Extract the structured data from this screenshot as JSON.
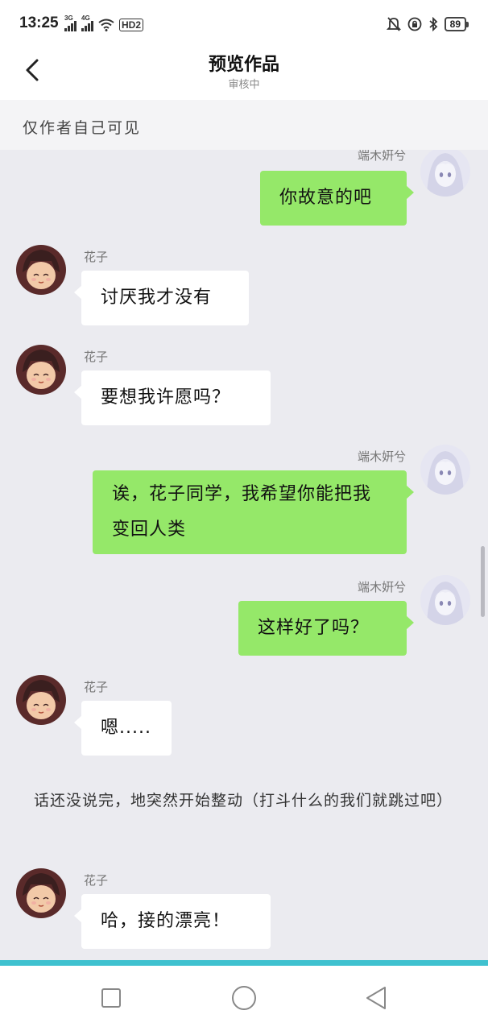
{
  "status": {
    "time": "13:25",
    "sim1": "3G",
    "sim2": "4G",
    "hd": "HD2",
    "battery": "89"
  },
  "header": {
    "title": "预览作品",
    "subtitle": "审核中"
  },
  "notice": "仅作者自己可见",
  "messages": [
    {
      "sender": "端木姸兮",
      "text": "你故意的吧",
      "side": "right"
    },
    {
      "sender": "花子",
      "text": "讨厌我才没有",
      "side": "left"
    },
    {
      "sender": "花子",
      "text": "要想我许愿吗？",
      "side": "left"
    },
    {
      "sender": "端木姸兮",
      "text": "诶，花子同学，我希望你能把我变回人类",
      "side": "right"
    },
    {
      "sender": "端木姸兮",
      "text": "这样好了吗？",
      "side": "right"
    },
    {
      "sender": "花子",
      "text": "嗯.....",
      "side": "left"
    },
    {
      "sender": "花子",
      "text": "哈，接的漂亮！",
      "side": "left"
    }
  ],
  "narration": "话还没说完，地突然开始整动（打斗什么的我们就跳过吧）",
  "colors": {
    "right_bubble": "#95e869",
    "left_bubble": "#ffffff",
    "chat_background": "#ebebf0",
    "progress_bar": "#3fc1cf"
  },
  "icons": {
    "back": "chevron-left-icon",
    "nav_recent": "square-icon",
    "nav_home": "circle-icon",
    "nav_back": "triangle-back-icon"
  }
}
